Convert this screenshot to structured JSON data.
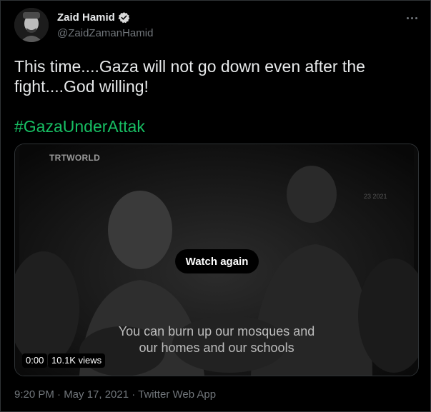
{
  "author": {
    "name": "Zaid Hamid",
    "handle": "@ZaidZamanHamid",
    "verified": true
  },
  "tweet": {
    "text": "This time....Gaza will not go down even after the fight....God willing!",
    "hashtag": "#GazaUnderAttak",
    "timestamp": "9:20 PM · May 17, 2021 · Twitter Web App"
  },
  "media": {
    "watermark": "TRTWORLD",
    "year_mark": "23 2021",
    "watch_again": "Watch again",
    "caption_line1": "You can burn up our mosques and",
    "caption_line2": "our homes and our schools",
    "time": "0:00",
    "views": "10.1K views"
  },
  "colors": {
    "background": "#000000",
    "text": "#e7e9ea",
    "secondary": "#71767b",
    "hashtag": "#17bf63",
    "verified": "#d9d9d9",
    "border": "#2f3336"
  }
}
